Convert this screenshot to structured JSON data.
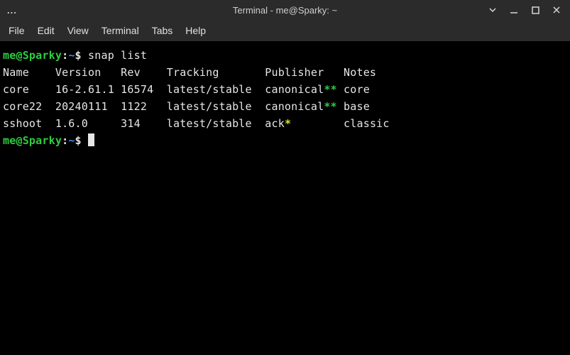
{
  "window": {
    "dots": "...",
    "title": "Terminal - me@Sparky: ~"
  },
  "menu": {
    "file": "File",
    "edit": "Edit",
    "view": "View",
    "terminal": "Terminal",
    "tabs": "Tabs",
    "help": "Help"
  },
  "prompt": {
    "user": "me@Sparky",
    "colon": ":",
    "path": "~",
    "dollar": "$"
  },
  "command": "snap list",
  "headers": {
    "name": "Name",
    "version": "Version",
    "rev": "Rev",
    "tracking": "Tracking",
    "publisher": "Publisher",
    "notes": "Notes"
  },
  "rows": [
    {
      "name": "core",
      "version": "16-2.61.1",
      "rev": "16574",
      "tracking": "latest/stable",
      "publisher": "canonical",
      "star": "**",
      "star_color": "green",
      "notes": "core"
    },
    {
      "name": "core22",
      "version": "20240111",
      "rev": "1122",
      "tracking": "latest/stable",
      "publisher": "canonical",
      "star": "**",
      "star_color": "green",
      "notes": "base"
    },
    {
      "name": "sshoot",
      "version": "1.6.0",
      "rev": "314",
      "tracking": "latest/stable",
      "publisher": "ack",
      "star": "*",
      "star_color": "yellow",
      "notes": "classic"
    }
  ]
}
